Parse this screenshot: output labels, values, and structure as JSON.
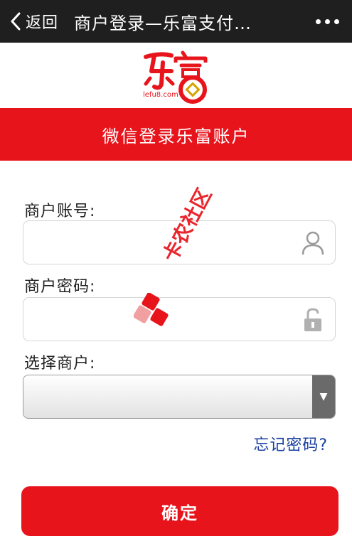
{
  "header": {
    "back_label": "返回",
    "title": "商户登录—乐富支付…"
  },
  "logo": {
    "brand_text": "乐富",
    "domain_text": "lefu8.com",
    "color": "#e8141c"
  },
  "banner": {
    "text": "微信登录乐富账户",
    "color": "#e8141c"
  },
  "form": {
    "account_label": "商户账号:",
    "account_value": "",
    "account_placeholder": "",
    "password_label": "商户密码:",
    "password_value": "",
    "password_placeholder": "",
    "merchant_label": "选择商户:",
    "merchant_selected": ""
  },
  "links": {
    "forgot_password": "忘记密码?"
  },
  "actions": {
    "submit_label": "确定"
  },
  "watermark": {
    "text": "卡农社区"
  },
  "icons": {
    "back": "chevron-left-icon",
    "more": "more-dots-icon",
    "account": "user-icon",
    "password": "lock-icon",
    "select": "triangle-down-icon"
  }
}
